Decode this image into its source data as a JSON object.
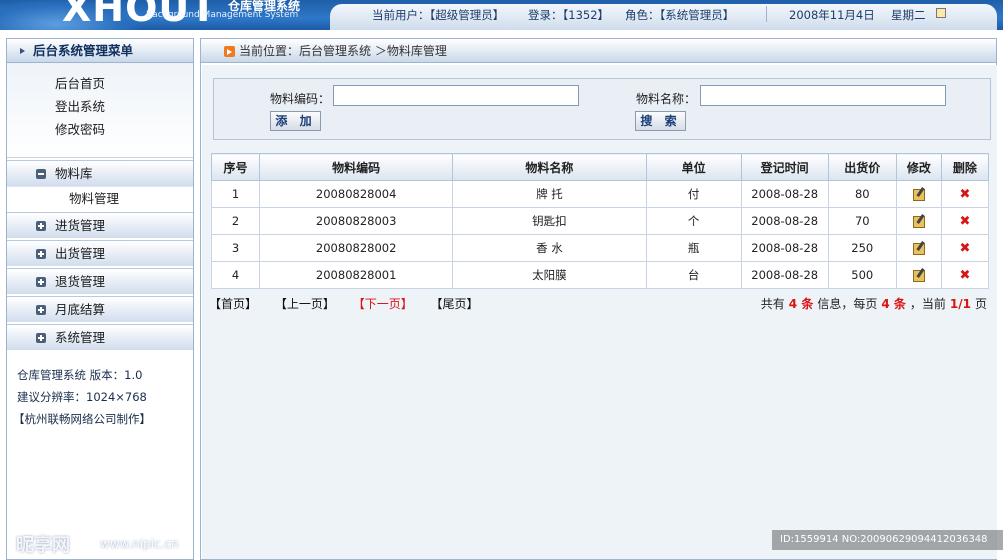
{
  "header": {
    "logo_glyph": "XHOUT",
    "logo_cn": "仓库管理系统",
    "logo_en": "Background Management System",
    "current_user": "当前用户：【超级管理员】",
    "login": "登录：【1352】",
    "role": "角色：【系统管理员】",
    "date": "2008年11月4日",
    "weekday": "星期二"
  },
  "sidebar": {
    "title": "后台系统管理菜单",
    "links": [
      "后台首页",
      "登出系统",
      "修改密码"
    ],
    "menus": [
      {
        "label": "物料库",
        "expanded": true,
        "sub": [
          "物料管理"
        ]
      },
      {
        "label": "进货管理",
        "expanded": false
      },
      {
        "label": "出货管理",
        "expanded": false
      },
      {
        "label": "退货管理",
        "expanded": false
      },
      {
        "label": "月底结算",
        "expanded": false
      },
      {
        "label": "系统管理",
        "expanded": false
      }
    ],
    "info": [
      "仓库管理系统 版本：1.0",
      "建议分辨率：1024×768",
      "【杭州联畅网络公司制作】"
    ]
  },
  "location": "当前位置：后台管理系统 ＞物料库管理",
  "search": {
    "code_label": "物料编码：",
    "code_value": "",
    "name_label": "物料名称：",
    "name_value": "",
    "add_label": "添 加",
    "search_label": "搜 索"
  },
  "table": {
    "headers": [
      "序号",
      "物料编码",
      "物料名称",
      "单位",
      "登记时间",
      "出货价",
      "修改",
      "删除"
    ],
    "rows": [
      [
        "1",
        "20080828004",
        "牌 托",
        "付",
        "2008-08-28",
        "80"
      ],
      [
        "2",
        "20080828003",
        "钥匙扣",
        "个",
        "2008-08-28",
        "70"
      ],
      [
        "3",
        "20080828002",
        "香 水",
        "瓶",
        "2008-08-28",
        "250"
      ],
      [
        "4",
        "20080828001",
        "太阳膜",
        "台",
        "2008-08-28",
        "500"
      ]
    ]
  },
  "pager": {
    "first": "【首页】",
    "prev": "【上一页】",
    "next": "【下一页】",
    "last": "【尾页】",
    "total_prefix": "共有",
    "total": "4 条",
    "per_prefix": "信息，每页",
    "per": "4 条",
    "current_prefix": "，当前",
    "current": "1/1",
    "page_suffix": "页"
  },
  "watermark": {
    "logo": "昵享网",
    "site": "www.nipic.cn",
    "id": "ID:1559914 NO:20090629094412036348"
  },
  "colors": {
    "header_blue": "#2e78c9",
    "accent_red": "#d81414",
    "border": "#9db3cf"
  }
}
